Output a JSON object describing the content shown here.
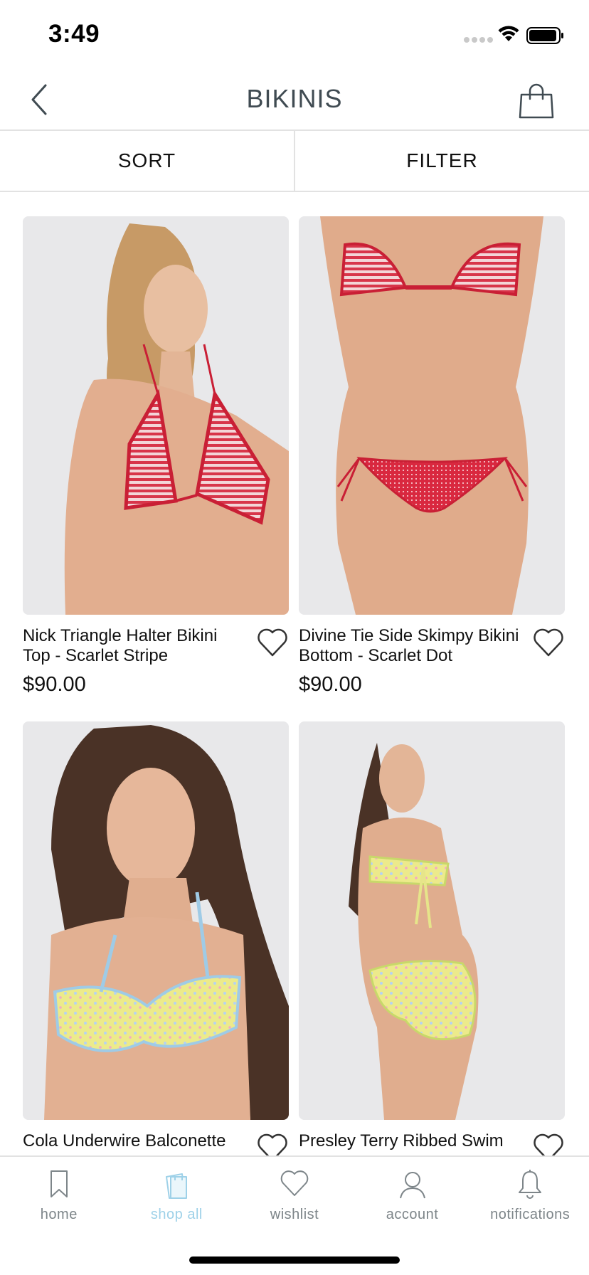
{
  "status_bar": {
    "time": "3:49"
  },
  "header": {
    "title": "BIKINIS"
  },
  "toolbar": {
    "sort_label": "SORT",
    "filter_label": "FILTER"
  },
  "products": [
    {
      "name": "Nick Triangle Halter Bikini Top - Scarlet Stripe",
      "price": "$90.00"
    },
    {
      "name": "Divine Tie Side Skimpy Bikini Bottom - Scarlet Dot",
      "price": "$90.00"
    },
    {
      "name": "Cola Underwire Balconette",
      "price": ""
    },
    {
      "name": "Presley Terry Ribbed Swim",
      "price": ""
    }
  ],
  "tabs": [
    {
      "label": "home",
      "icon": "bookmark-icon"
    },
    {
      "label": "shop all",
      "icon": "shopping-bag-icon",
      "active": true
    },
    {
      "label": "wishlist",
      "icon": "heart-icon"
    },
    {
      "label": "account",
      "icon": "person-icon"
    },
    {
      "label": "notifications",
      "icon": "bell-icon"
    }
  ],
  "colors": {
    "active_tab": "#9ed1e8",
    "inactive_tab": "#7d8589",
    "title": "#404b52",
    "divider": "#e2e2e2"
  }
}
